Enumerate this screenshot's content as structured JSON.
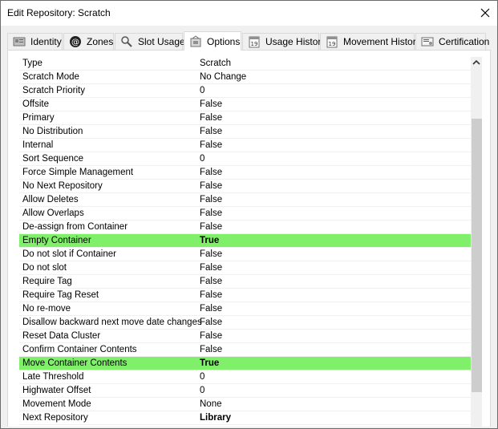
{
  "window": {
    "title": "Edit Repository: Scratch"
  },
  "tabs": [
    {
      "label": "Identity",
      "icon": "identity-icon",
      "active": false
    },
    {
      "label": "Zones",
      "icon": "zones-icon",
      "active": false
    },
    {
      "label": "Slot Usage",
      "icon": "magnifier-icon",
      "active": false
    },
    {
      "label": "Options",
      "icon": "options-icon",
      "active": true
    },
    {
      "label": "Usage History",
      "icon": "calendar-icon",
      "active": false
    },
    {
      "label": "Movement History",
      "icon": "calendar-icon",
      "active": false
    },
    {
      "label": "Certification",
      "icon": "certificate-icon",
      "active": false
    }
  ],
  "colors": {
    "highlight": "#80ef6a"
  },
  "properties": [
    {
      "name": "Type",
      "value": "Scratch",
      "highlight": false,
      "bold": false
    },
    {
      "name": "Scratch Mode",
      "value": "No Change",
      "highlight": false,
      "bold": false
    },
    {
      "name": "Scratch Priority",
      "value": "0",
      "highlight": false,
      "bold": false
    },
    {
      "name": "Offsite",
      "value": "False",
      "highlight": false,
      "bold": false
    },
    {
      "name": "Primary",
      "value": "False",
      "highlight": false,
      "bold": false
    },
    {
      "name": "No Distribution",
      "value": "False",
      "highlight": false,
      "bold": false
    },
    {
      "name": "Internal",
      "value": "False",
      "highlight": false,
      "bold": false
    },
    {
      "name": "Sort Sequence",
      "value": "0",
      "highlight": false,
      "bold": false
    },
    {
      "name": "Force Simple Management",
      "value": "False",
      "highlight": false,
      "bold": false
    },
    {
      "name": "No Next Repository",
      "value": "False",
      "highlight": false,
      "bold": false
    },
    {
      "name": "Allow Deletes",
      "value": "False",
      "highlight": false,
      "bold": false
    },
    {
      "name": "Allow Overlaps",
      "value": "False",
      "highlight": false,
      "bold": false
    },
    {
      "name": "De-assign from Container",
      "value": "False",
      "highlight": false,
      "bold": false
    },
    {
      "name": "Empty Container",
      "value": "True",
      "highlight": true,
      "bold": true
    },
    {
      "name": "Do not slot if Container",
      "value": "False",
      "highlight": false,
      "bold": false
    },
    {
      "name": "Do not slot",
      "value": "False",
      "highlight": false,
      "bold": false
    },
    {
      "name": "Require Tag",
      "value": "False",
      "highlight": false,
      "bold": false
    },
    {
      "name": "Require Tag Reset",
      "value": "False",
      "highlight": false,
      "bold": false
    },
    {
      "name": "No re-move",
      "value": "False",
      "highlight": false,
      "bold": false
    },
    {
      "name": "Disallow backward next move date changes",
      "value": "False",
      "highlight": false,
      "bold": false
    },
    {
      "name": "Reset Data Cluster",
      "value": "False",
      "highlight": false,
      "bold": false
    },
    {
      "name": "Confirm Container Contents",
      "value": "False",
      "highlight": false,
      "bold": false
    },
    {
      "name": "Move Container Contents",
      "value": "True",
      "highlight": true,
      "bold": true
    },
    {
      "name": "Late Threshold",
      "value": "0",
      "highlight": false,
      "bold": false
    },
    {
      "name": "Highwater Offset",
      "value": "0",
      "highlight": false,
      "bold": false
    },
    {
      "name": "Movement Mode",
      "value": "None",
      "highlight": false,
      "bold": false
    },
    {
      "name": "Next Repository",
      "value": "Library",
      "highlight": false,
      "bold": true
    }
  ]
}
